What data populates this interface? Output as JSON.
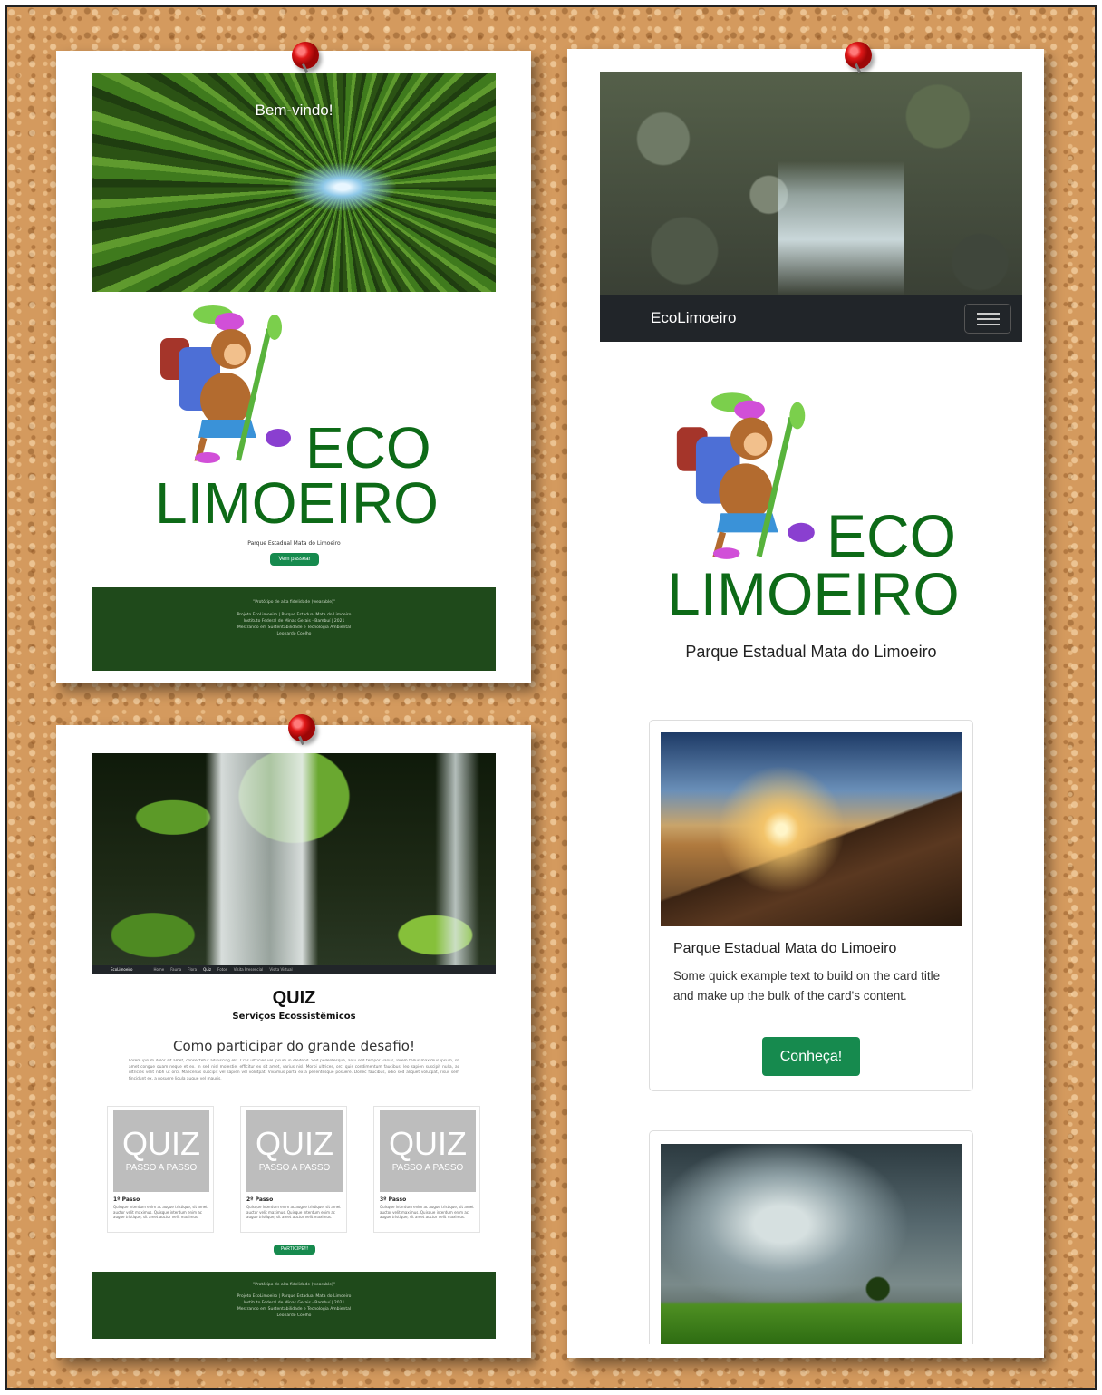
{
  "colors": {
    "brand_green": "#0d6a17",
    "button_green": "#168a4e",
    "footer_green": "#1f4a1b",
    "navbar_dark": "#212529",
    "pin_red": "#e01818"
  },
  "icons": [
    "pushpin-icon",
    "hamburger-menu-icon",
    "monkey-mascot-icon"
  ],
  "poster1": {
    "hero_text": "Bem-vindo!",
    "logo_line1": "ECO",
    "logo_line2": "LIMOEIRO",
    "subtitle": "Parque Estadual Mata do Limoeiro",
    "button": "Vem passear",
    "footer": {
      "tagline": "\"Protótipo de alta fidelidade (wearable)\"",
      "line1": "Projeto EcoLimoeiro | Parque Estadual Mata do Limoeiro",
      "line2": "Instituto Federal de Minas Gerais - Bambuí | 2021",
      "line3": "Mestrando em Sustentabilidade e Tecnologia Ambiental",
      "line4": "Leonardo Coelho"
    }
  },
  "poster2": {
    "navbar": {
      "brand": "EcoLimoeiro",
      "links": [
        "Home",
        "Fauna",
        "Flora",
        "Quiz",
        "Fotos",
        "Visita Presencial",
        "Visita Virtual"
      ]
    },
    "title": "QUIZ",
    "subtitle": "Serviços Ecossistêmicos",
    "heading": "Como participar do grande desafio!",
    "body": "Lorem ipsum dolor sit amet, consectetur adipiscing elit. Cras ultricies vel ipsum in eleifend. Sed pellentesque, arcu sed tempor varius, lorem tellus maximus ipsum, sit amet congue quam neque et ex. In sed nisl molestie, efficitur ex sit amet, varius nisl. Morbi ultrices, orci quis condimentum faucibus, leo sapien suscipit nulla, ac ultricies velit nibh ut orci. Maecenas suscipit vel sapien vel volutpat. Vivamus porta ex a pellentesque posuere. Donec faucibus, odio sed aliquet volutpat, risus sem tincidunt ex, a posuere ligula augue vel mauris.",
    "cards": [
      {
        "tile_title": "QUIZ",
        "tile_sub": "PASSO A PASSO",
        "step": "1º Passo",
        "text": "Quisque interdum enim ac augue tristique, sit amet auctor velit maximus. Quisque interdum enim ac augue tristique, sit amet auctor velit maximus."
      },
      {
        "tile_title": "QUIZ",
        "tile_sub": "PASSO A PASSO",
        "step": "2º Passo",
        "text": "Quisque interdum enim ac augue tristique, sit amet auctor velit maximus. Quisque interdum enim ac augue tristique, sit amet auctor velit maximus."
      },
      {
        "tile_title": "QUIZ",
        "tile_sub": "PASSO A PASSO",
        "step": "3º Passo",
        "text": "Quisque interdum enim ac augue tristique, sit amet auctor velit maximus. Quisque interdum enim ac augue tristique, sit amet auctor velit maximus."
      }
    ],
    "button": "PARTICIPE!!!",
    "footer": {
      "tagline": "\"Protótipo de alta fidelidade (wearable)\"",
      "line1": "Projeto EcoLimoeiro | Parque Estadual Mata do Limoeiro",
      "line2": "Instituto Federal de Minas Gerais - Bambuí | 2021",
      "line3": "Mestrando em Sustentabilidade e Tecnologia Ambiental",
      "line4": "Leonardo Coelho"
    }
  },
  "poster3": {
    "navbar": {
      "brand": "EcoLimoeiro"
    },
    "logo_line1": "ECO",
    "logo_line2": "LIMOEIRO",
    "subtitle": "Parque Estadual Mata do Limoeiro",
    "card1": {
      "title": "Parque Estadual Mata do Limoeiro",
      "text": "Some quick example text to build on the card title and make up the bulk of the card's content.",
      "button": "Conheça!"
    }
  }
}
